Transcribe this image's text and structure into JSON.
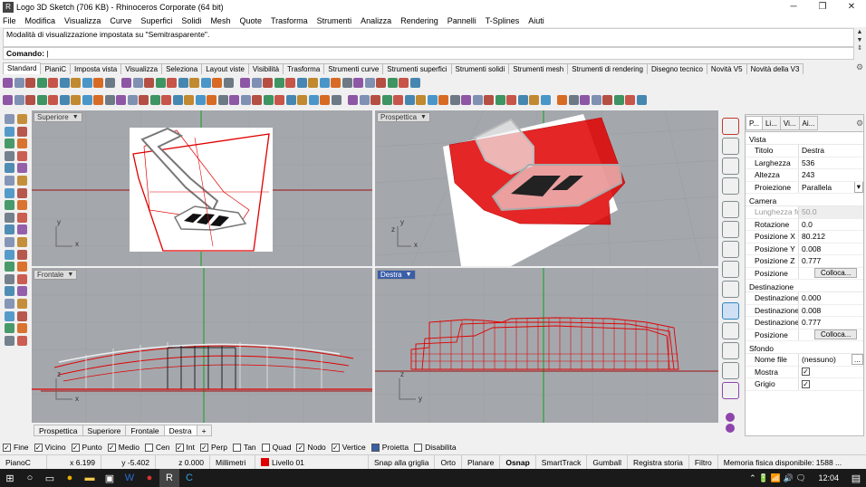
{
  "window": {
    "title": "Logo 3D Sketch (706 KB) - Rhinoceros Corporate (64 bit)",
    "minimize": "─",
    "restore": "❐",
    "close": "✕"
  },
  "menu": [
    "File",
    "Modifica",
    "Visualizza",
    "Curve",
    "Superfici",
    "Solidi",
    "Mesh",
    "Quote",
    "Trasforma",
    "Strumenti",
    "Analizza",
    "Rendering",
    "Pannelli",
    "T-Splines",
    "Aiuti"
  ],
  "command": {
    "history": "Modalità di visualizzazione impostata su \"Semitrasparente\".",
    "prompt": "Comando:"
  },
  "toolbar_tabs": [
    "Standard",
    "PianiC",
    "Imposta vista",
    "Visualizza",
    "Seleziona",
    "Layout viste",
    "Visibilità",
    "Trasforma",
    "Strumenti curve",
    "Strumenti superfici",
    "Strumenti solidi",
    "Strumenti mesh",
    "Strumenti di rendering",
    "Disegno tecnico",
    "Novità V5",
    "Novità della V3"
  ],
  "active_toolbar_tab": "Standard",
  "viewports": {
    "top": {
      "label": "Superiore"
    },
    "perspective": {
      "label": "Prospettica"
    },
    "front": {
      "label": "Frontale"
    },
    "right": {
      "label": "Destra"
    }
  },
  "viewport_tabs": [
    "Prospettica",
    "Superiore",
    "Frontale",
    "Destra"
  ],
  "active_viewport_tab": "Destra",
  "viewport_tab_add": "+",
  "panel": {
    "tabs": [
      "P...",
      "Li...",
      "Vi...",
      "Ai..."
    ],
    "sections": {
      "vista": "Vista",
      "camera": "Camera",
      "destinazione": "Destinazione",
      "sfondo": "Sfondo"
    },
    "vista_rows": [
      {
        "k": "Titolo",
        "v": "Destra"
      },
      {
        "k": "Larghezza",
        "v": "536"
      },
      {
        "k": "Altezza",
        "v": "243"
      },
      {
        "k": "Proiezione",
        "v": "Parallela"
      }
    ],
    "camera_rows": [
      {
        "k": "Lunghezza fo...",
        "v": "50.0"
      },
      {
        "k": "Rotazione",
        "v": "0.0"
      },
      {
        "k": "Posizione X",
        "v": "80.212"
      },
      {
        "k": "Posizione Y",
        "v": "0.008"
      },
      {
        "k": "Posizione Z",
        "v": "0.777"
      },
      {
        "k": "Posizione",
        "v": "Colloca..."
      }
    ],
    "dest_rows": [
      {
        "k": "Destinazione X",
        "v": "0.000"
      },
      {
        "k": "Destinazione Y",
        "v": "0.008"
      },
      {
        "k": "Destinazione Z",
        "v": "0.777"
      },
      {
        "k": "Posizione",
        "v": "Colloca..."
      }
    ],
    "sfondo_rows": [
      {
        "k": "Nome file",
        "v": "(nessuno)"
      },
      {
        "k": "Mostra",
        "v": "✓"
      },
      {
        "k": "Grigio",
        "v": "✓"
      }
    ]
  },
  "osnap": [
    {
      "label": "Fine",
      "checked": true
    },
    {
      "label": "Vicino",
      "checked": true
    },
    {
      "label": "Punto",
      "checked": true
    },
    {
      "label": "Medio",
      "checked": true
    },
    {
      "label": "Cen",
      "checked": false
    },
    {
      "label": "Int",
      "checked": true
    },
    {
      "label": "Perp",
      "checked": true
    },
    {
      "label": "Tan",
      "checked": false
    },
    {
      "label": "Quad",
      "checked": false
    },
    {
      "label": "Nodo",
      "checked": true
    },
    {
      "label": "Vertice",
      "checked": true
    },
    {
      "label": "Proietta",
      "checked": false
    },
    {
      "label": "Disabilita",
      "checked": false
    }
  ],
  "status": {
    "cplane": "PianoC",
    "x": "x 6.199",
    "y": "y -5.402",
    "z": "z 0.000",
    "units": "Millimetri",
    "layer": "Livello 01",
    "layer_color": "#e00000",
    "grid_snap": "Snap alla griglia",
    "ortho": "Orto",
    "planar": "Planare",
    "osnap": "Osnap",
    "smarttrack": "SmartTrack",
    "gumball": "Gumball",
    "history": "Registra storia",
    "filter": "Filtro",
    "memory": "Memoria fisica disponibile: 1588 ..."
  },
  "taskbar": {
    "time": "12:04"
  }
}
